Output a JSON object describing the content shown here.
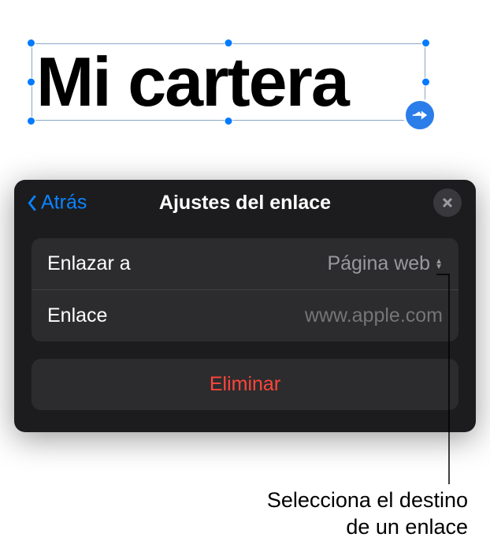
{
  "textbox": {
    "content": "Mi cartera"
  },
  "popover": {
    "back_label": "Atrás",
    "title": "Ajustes del enlace",
    "rows": {
      "link_to": {
        "label": "Enlazar a",
        "value": "Página web"
      },
      "link": {
        "label": "Enlace",
        "placeholder": "www.apple.com"
      }
    },
    "delete_label": "Eliminar"
  },
  "caption": {
    "line1": "Selecciona el destino",
    "line2": "de un enlace"
  }
}
